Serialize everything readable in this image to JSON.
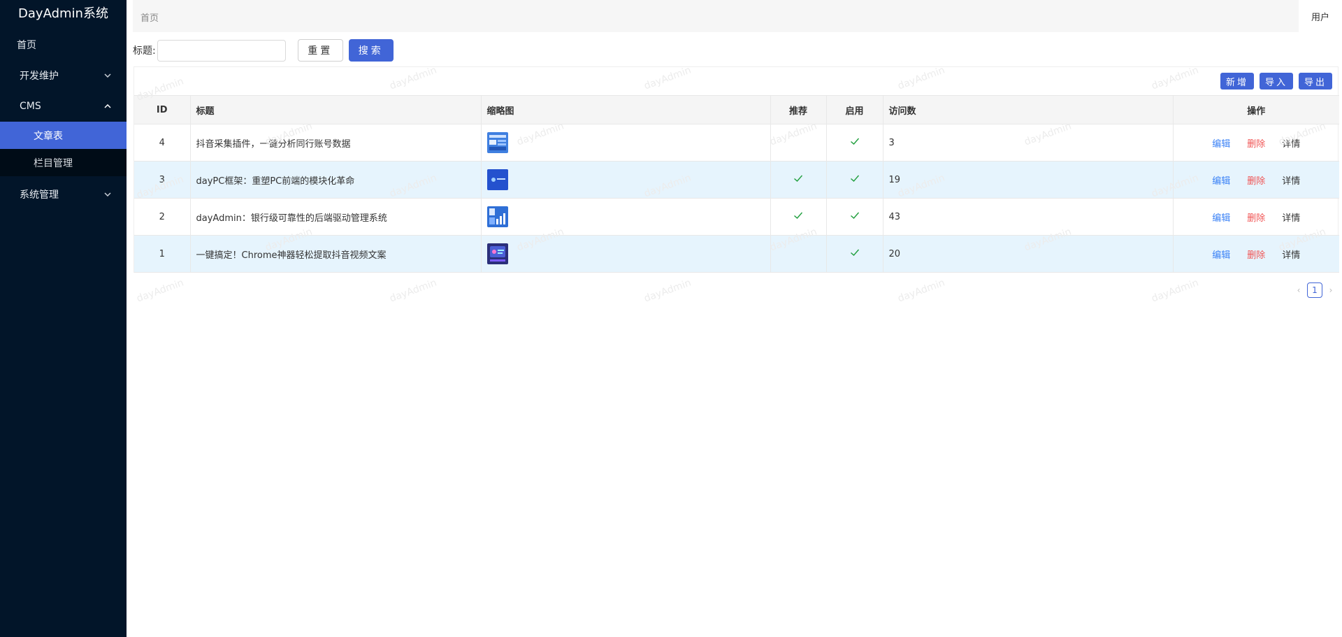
{
  "app": {
    "title": "DayAdmin系统"
  },
  "sidebar": {
    "home": "首页",
    "groups": [
      {
        "label": "开发维护",
        "expanded": false
      },
      {
        "label": "CMS",
        "expanded": true,
        "children": [
          {
            "label": "文章表",
            "active": true
          },
          {
            "label": "栏目管理",
            "active": false
          }
        ]
      },
      {
        "label": "系统管理",
        "expanded": false
      }
    ]
  },
  "header": {
    "breadcrumb": "首页",
    "user": "用户"
  },
  "search": {
    "label": "标题:",
    "value": "",
    "placeholder": "",
    "reset": "重置",
    "submit": "搜索"
  },
  "toolbar": {
    "add": "新增",
    "import": "导入",
    "export": "导出"
  },
  "table": {
    "columns": [
      "ID",
      "标题",
      "缩略图",
      "推荐",
      "启用",
      "访问数",
      "操作"
    ],
    "rows": [
      {
        "id": "4",
        "title": "抖音采集插件，一键分析同行账号数据",
        "thumb": "thumb-1",
        "recommend": false,
        "enabled": true,
        "visits": "3"
      },
      {
        "id": "3",
        "title": "dayPC框架：重塑PC前端的模块化革命",
        "thumb": "thumb-2",
        "recommend": true,
        "enabled": true,
        "visits": "19"
      },
      {
        "id": "2",
        "title": "dayAdmin：银行级可靠性的后端驱动管理系统",
        "thumb": "thumb-3",
        "recommend": true,
        "enabled": true,
        "visits": "43"
      },
      {
        "id": "1",
        "title": "一键搞定！Chrome神器轻松提取抖音视频文案",
        "thumb": "thumb-4",
        "recommend": false,
        "enabled": true,
        "visits": "20"
      }
    ],
    "actions": {
      "edit": "编辑",
      "delete": "删除",
      "detail": "详情"
    }
  },
  "pagination": {
    "current": "1"
  },
  "watermark": "dayAdmin",
  "colors": {
    "sidebar_bg": "#021529",
    "accent": "#4165d7",
    "delete": "#f05454",
    "row_highlight": "#e6f4fd",
    "check": "#1e9e3c"
  }
}
